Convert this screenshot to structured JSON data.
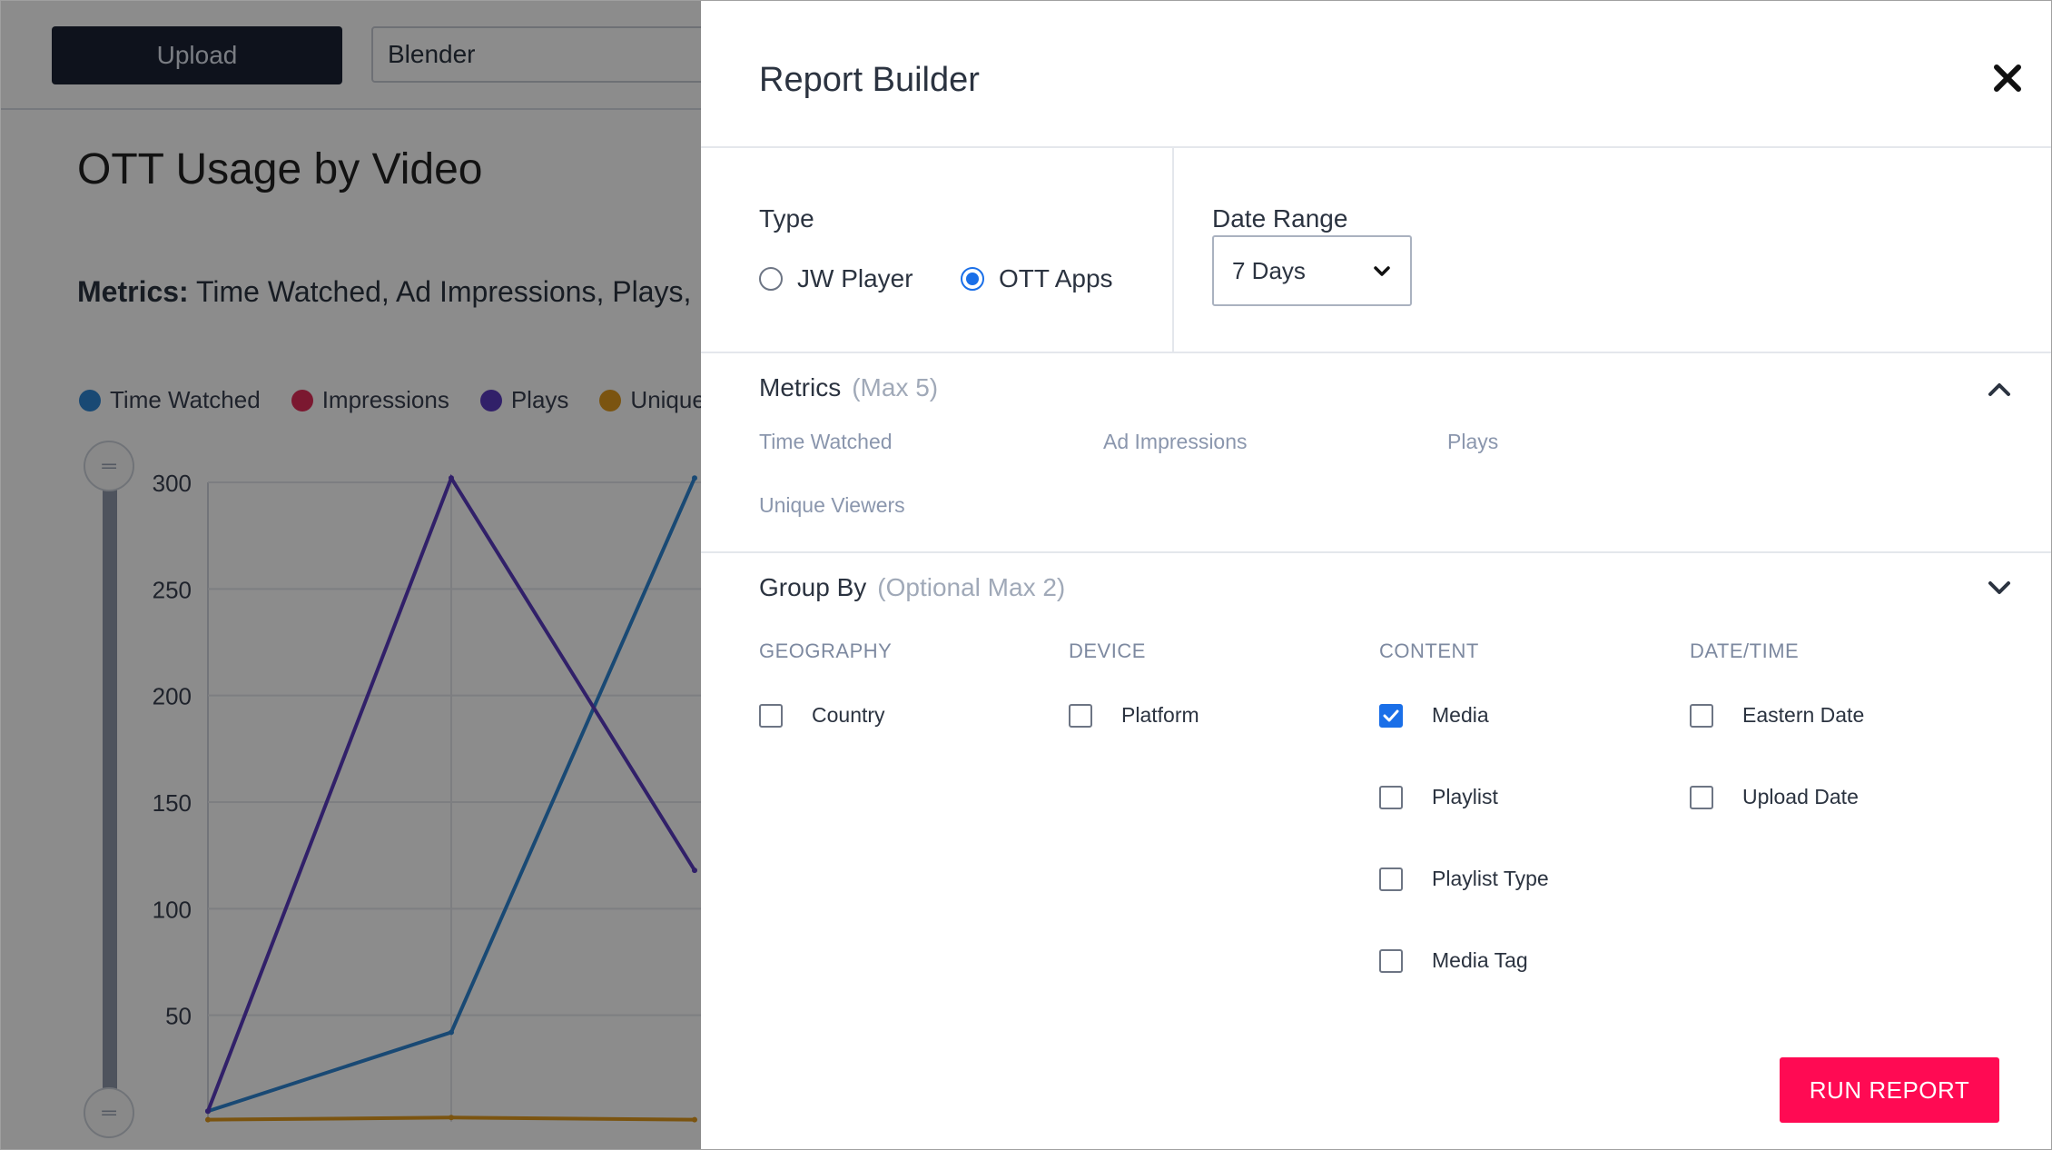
{
  "background": {
    "upload_label": "Upload",
    "media_search_value": "Blender",
    "title": "OTT Usage by Video",
    "metrics_prefix": "Metrics:",
    "metrics_text": " Time Watched, Ad Impressions, Plays, U",
    "legend": [
      {
        "label": "Time Watched",
        "color": "#2f86d4"
      },
      {
        "label": "Impressions",
        "color": "#e02d58"
      },
      {
        "label": "Plays",
        "color": "#5a3bbf"
      },
      {
        "label": "Unique",
        "color": "#e09a1e"
      }
    ]
  },
  "chart_data": {
    "type": "line",
    "x": [
      0,
      1,
      2,
      3
    ],
    "ylim": [
      0,
      300
    ],
    "y_ticks": [
      "300",
      "250",
      "200",
      "150",
      "100",
      "50"
    ],
    "series": [
      {
        "name": "Time Watched",
        "color": "#2f86d4",
        "values": [
          5,
          42,
          302,
          null
        ]
      },
      {
        "name": "Plays",
        "color": "#5a3bbf",
        "values": [
          5,
          302,
          118,
          null
        ]
      },
      {
        "name": "Unique",
        "color": "#e09a1e",
        "values": [
          1,
          2,
          1,
          null
        ]
      }
    ]
  },
  "modal": {
    "title": "Report Builder",
    "type_label": "Type",
    "type_options": [
      {
        "label": "JW Player",
        "checked": false
      },
      {
        "label": "OTT Apps",
        "checked": true
      }
    ],
    "date_range_label": "Date Range",
    "date_range_value": "7 Days",
    "metrics_label": "Metrics",
    "metrics_hint": "(Max 5)",
    "metric_options": [
      "Time Watched",
      "Ad Impressions",
      "Plays",
      "Unique Viewers"
    ],
    "group_by_label": "Group By",
    "group_by_hint": "(Optional Max 2)",
    "columns": [
      {
        "heading": "GEOGRAPHY",
        "items": [
          {
            "label": "Country",
            "checked": false
          }
        ]
      },
      {
        "heading": "DEVICE",
        "items": [
          {
            "label": "Platform",
            "checked": false
          }
        ]
      },
      {
        "heading": "CONTENT",
        "items": [
          {
            "label": "Media",
            "checked": true
          },
          {
            "label": "Playlist",
            "checked": false
          },
          {
            "label": "Playlist Type",
            "checked": false
          },
          {
            "label": "Media Tag",
            "checked": false
          }
        ]
      },
      {
        "heading": "DATE/TIME",
        "items": [
          {
            "label": "Eastern Date",
            "checked": false
          },
          {
            "label": "Upload Date",
            "checked": false
          }
        ]
      }
    ],
    "run_label": "RUN REPORT"
  }
}
